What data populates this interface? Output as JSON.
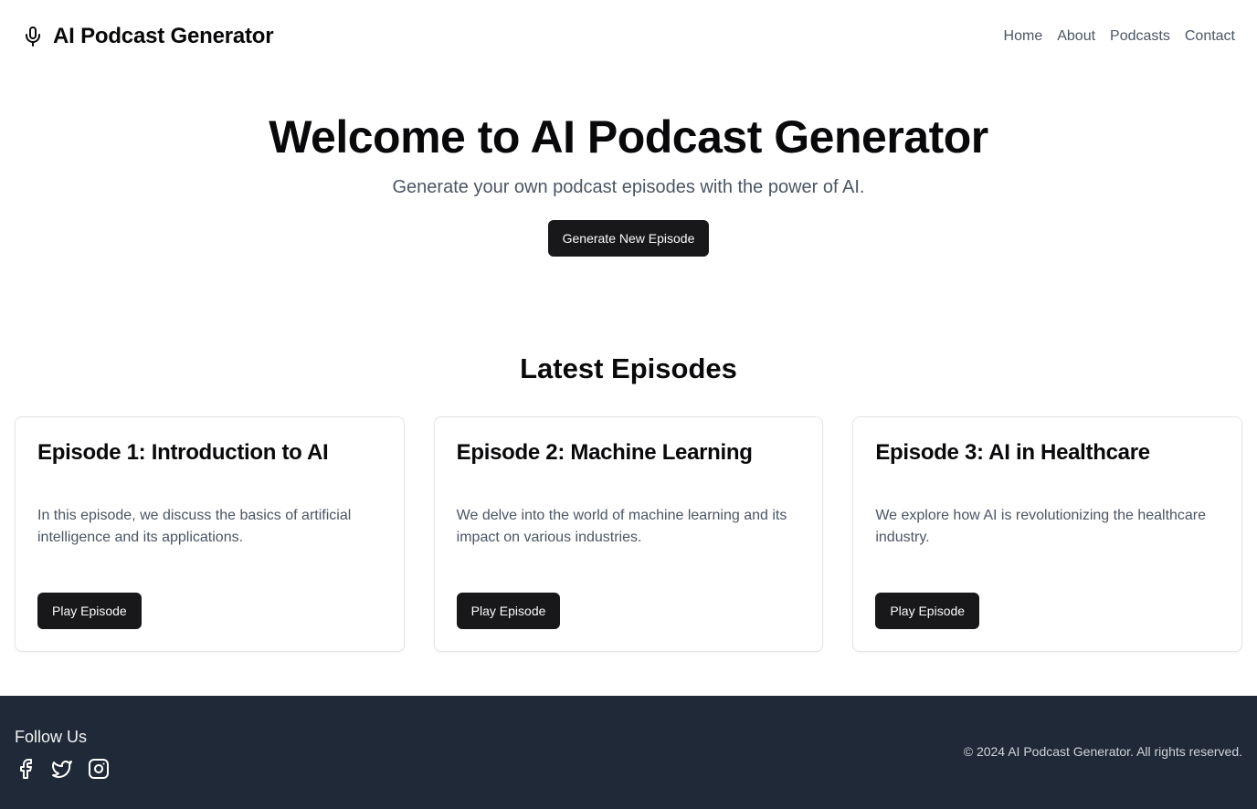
{
  "header": {
    "brand_title": "AI Podcast Generator",
    "brand_icon": "microphone-icon",
    "nav": [
      {
        "label": "Home"
      },
      {
        "label": "About"
      },
      {
        "label": "Podcasts"
      },
      {
        "label": "Contact"
      }
    ]
  },
  "hero": {
    "title": "Welcome to AI Podcast Generator",
    "subtitle": "Generate your own podcast episodes with the power of AI.",
    "cta_label": "Generate New Episode"
  },
  "episodes": {
    "section_title": "Latest Episodes",
    "items": [
      {
        "title": "Episode 1: Introduction to AI",
        "description": "In this episode, we discuss the basics of artificial intelligence and its applications.",
        "button_label": "Play Episode"
      },
      {
        "title": "Episode 2: Machine Learning",
        "description": "We delve into the world of machine learning and its impact on various industries.",
        "button_label": "Play Episode"
      },
      {
        "title": "Episode 3: AI in Healthcare",
        "description": "We explore how AI is revolutionizing the healthcare industry.",
        "button_label": "Play Episode"
      }
    ]
  },
  "footer": {
    "follow_label": "Follow Us",
    "socials": [
      "facebook-icon",
      "twitter-icon",
      "instagram-icon"
    ],
    "copyright": "© 2024 AI Podcast Generator. All rights reserved."
  },
  "colors": {
    "primary_button": "#18181b",
    "footer_bg": "#1f2937",
    "muted_text": "#4b5563"
  }
}
